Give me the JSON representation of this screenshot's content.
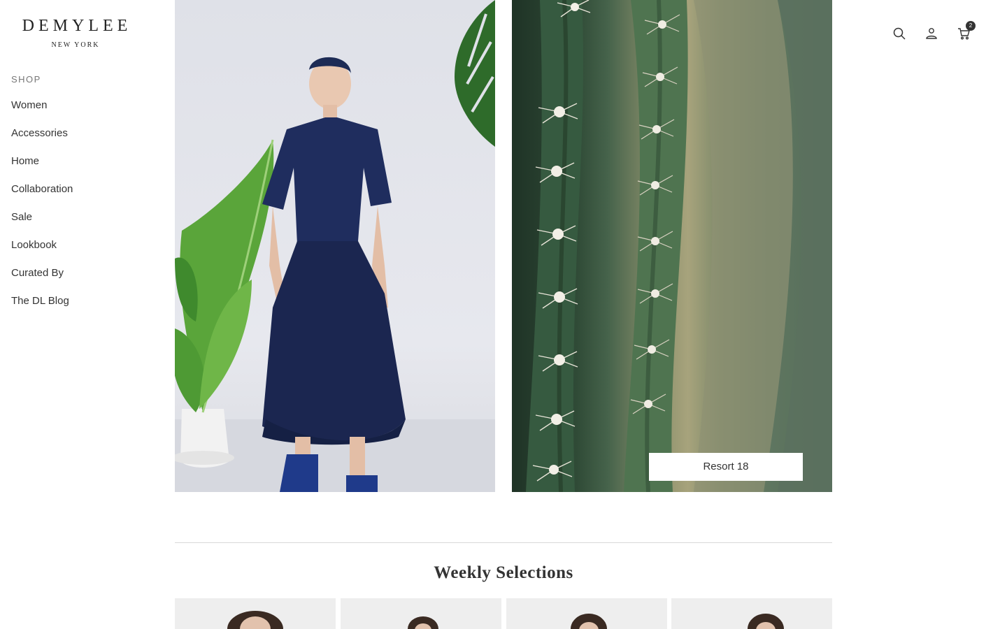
{
  "brand": {
    "name": "DEMYLEE",
    "location": "NEW YORK"
  },
  "sidebar": {
    "heading": "SHOP",
    "items": [
      {
        "label": "Women"
      },
      {
        "label": "Accessories"
      },
      {
        "label": "Home"
      },
      {
        "label": "Collaboration"
      },
      {
        "label": "Sale"
      },
      {
        "label": "Lookbook"
      },
      {
        "label": "Curated By"
      },
      {
        "label": "The DL Blog"
      }
    ]
  },
  "header": {
    "icons": [
      "search-icon",
      "account-icon",
      "cart-icon"
    ],
    "cart_count": "2"
  },
  "hero": {
    "left_image": "model-navy-dress-with-plants",
    "right_image": "cactus-closeup",
    "cta_label": "Resort 18"
  },
  "weekly": {
    "title": "Weekly Selections",
    "product_count": 4
  },
  "colors": {
    "text": "#333333",
    "muted": "#777777",
    "badge": "#333333"
  }
}
